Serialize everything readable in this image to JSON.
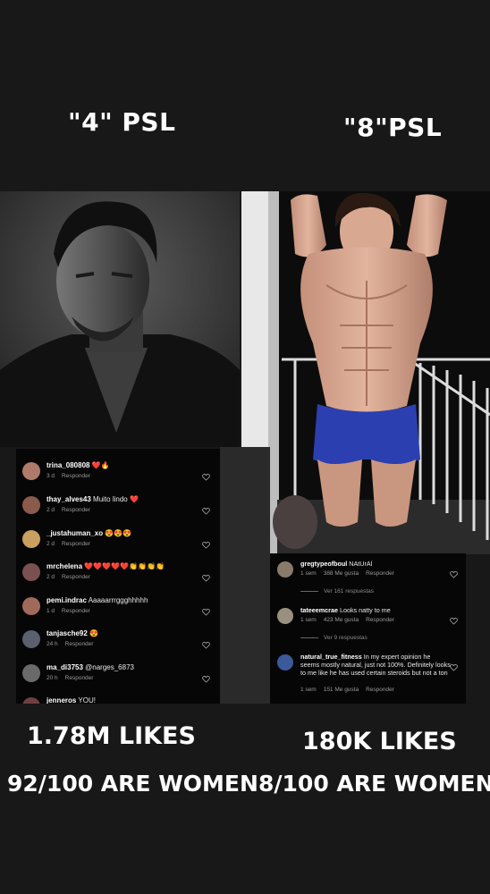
{
  "left_title": "\"4\" PSL",
  "right_title": "\"8\"PSL",
  "left_comments": [
    {
      "user": "trina_080808",
      "text": "❤️🔥",
      "time": "3 d",
      "reply": "Responder"
    },
    {
      "user": "thay_alves43",
      "text": "Muito lindo ❤️",
      "time": "2 d",
      "reply": "Responder"
    },
    {
      "user": "_justahuman_xo",
      "text": "😍😍😍",
      "time": "2 d",
      "reply": "Responder"
    },
    {
      "user": "mrchelena",
      "text": "❤️❤️❤️❤️❤️👏👏👏👏",
      "time": "2 d",
      "reply": "Responder"
    },
    {
      "user": "pemi.indrac",
      "text": "Aaaaarrrggghhhhh",
      "time": "1 d",
      "reply": "Responder"
    },
    {
      "user": "tanjasche92",
      "text": "😍",
      "time": "24 h",
      "reply": "Responder"
    },
    {
      "user": "ma_di3753",
      "text": "@narges_6873",
      "time": "20 h",
      "reply": "Responder"
    },
    {
      "user": "jenneros",
      "text": "YOU!",
      "time": "",
      "reply": ""
    }
  ],
  "right_comments": [
    {
      "user": "gregtypeofboul",
      "text": "NAtUrAl",
      "time": "1 sem",
      "likes": "388 Me gusta",
      "reply": "Responder",
      "replies": "Ver 161 respuestas"
    },
    {
      "user": "tateeemcrae",
      "text": "Looks natty to me",
      "time": "1 sem",
      "likes": "423 Me gusta",
      "reply": "Responder",
      "replies": "Ver 9 respuestas"
    },
    {
      "user": "natural_true_fitness",
      "text": "In my expert opinion he seems mostly natural, just not 100%. Definitely looks to me like he has used certain steroids but not a ton",
      "time": "1 sem",
      "likes": "151 Me gusta",
      "reply": "Responder",
      "replies": ""
    }
  ],
  "left_likes": "1.78M LIKES",
  "right_likes": "180K LIKES",
  "left_women": "92/100 ARE WOMEN",
  "right_women": "8/100 ARE WOMEN",
  "colors": {
    "background": "#181818",
    "comment_bg": "#060606",
    "shorts": "#2b3fb0"
  }
}
